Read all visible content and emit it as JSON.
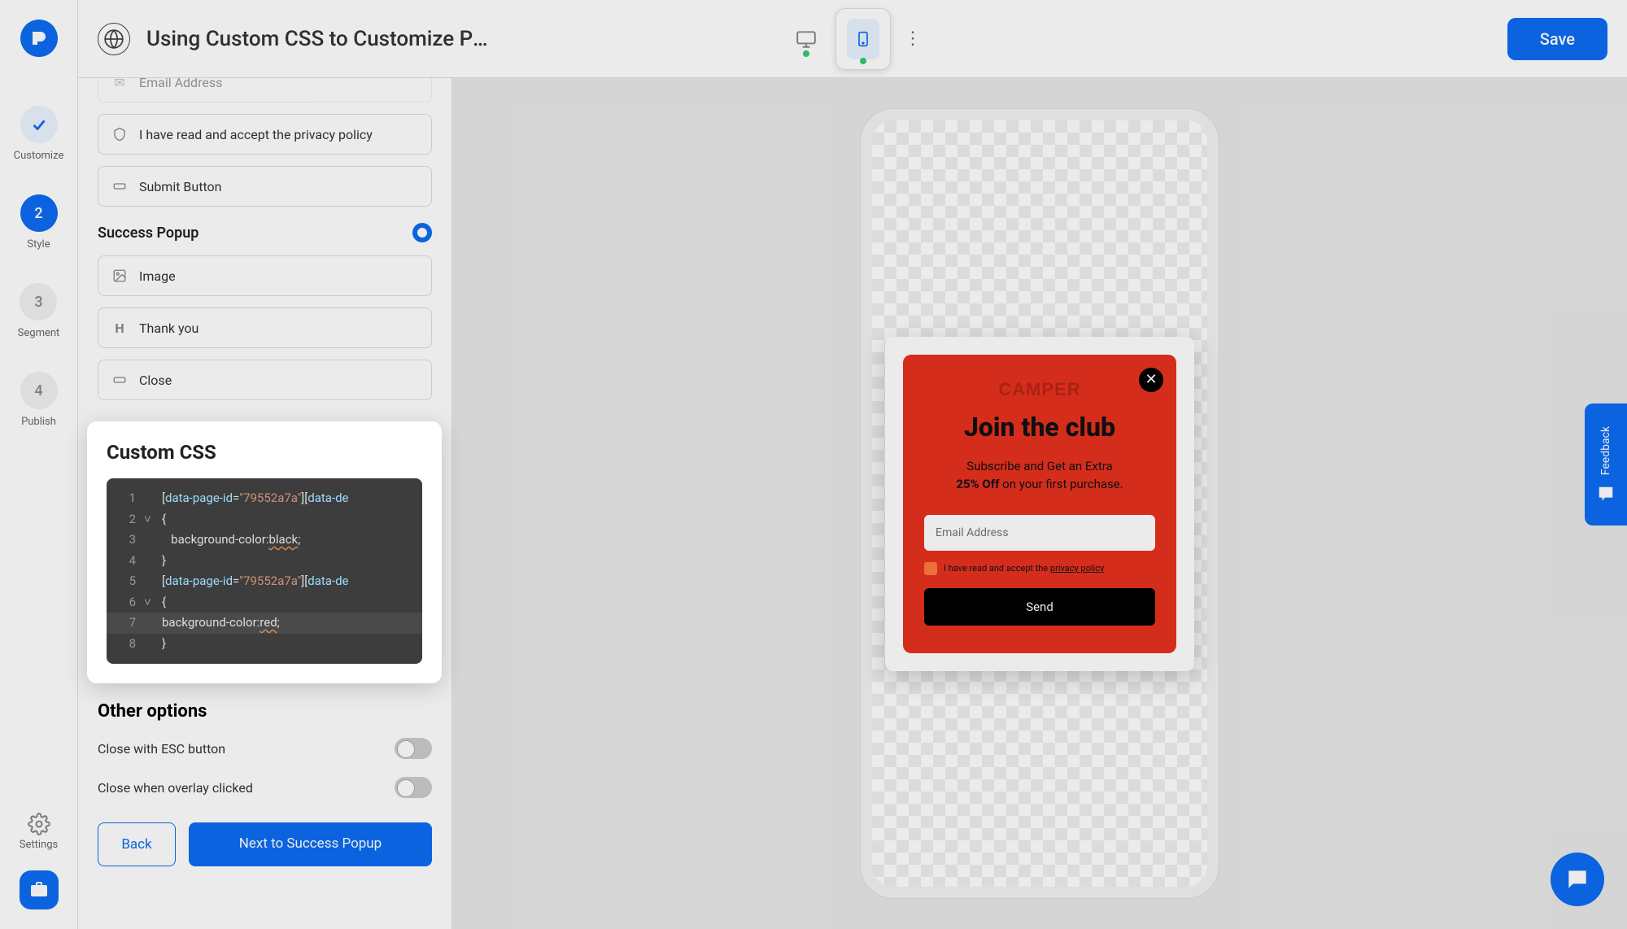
{
  "header": {
    "title": "Using Custom CSS to Customize Pop...",
    "save": "Save"
  },
  "rail": {
    "customize": "Customize",
    "style_num": "2",
    "style": "Style",
    "segment_num": "3",
    "segment": "Segment",
    "publish_num": "4",
    "publish": "Publish",
    "settings": "Settings"
  },
  "sidebar": {
    "email_row": "Email Address",
    "privacy_row": "I have read and accept the privacy policy",
    "submit_row": "Submit Button",
    "success_heading": "Success Popup",
    "image_row": "Image",
    "thank_row": "Thank you",
    "close_row": "Close",
    "css_heading": "Custom CSS",
    "other_heading": "Other options",
    "opt_esc": "Close with ESC button",
    "opt_overlay": "Close when overlay clicked",
    "back": "Back",
    "next": "Next to Success Popup"
  },
  "code": {
    "l1a": "[",
    "l1b": "data-page-id",
    "l1c": "=",
    "l1d": "\"79552a7a\"",
    "l1e": "][",
    "l1f": "data-de",
    "l2": "{",
    "l3a": "background-color:",
    "l3b": "black",
    "l3c": ";",
    "l4": "}",
    "l5a": "[",
    "l5b": "data-page-id",
    "l5c": "=",
    "l5d": "\"79552a7a\"",
    "l5e": "][",
    "l5f": "data-de",
    "l6": "{",
    "l7a": "background-color:",
    "l7b": "red",
    "l7c": ";",
    "l8": "}",
    "n1": "1",
    "n2": "2",
    "n3": "3",
    "n4": "4",
    "n5": "5",
    "n6": "6",
    "n7": "7",
    "n8": "8"
  },
  "popup": {
    "logo": "CAMPER",
    "title": "Join the club",
    "sub_pre": "Subscribe and Get an Extra",
    "sub_bold": "25% Off",
    "sub_post": " on your first purchase.",
    "placeholder": "Email Address",
    "privacy_pre": "I have read and accept the ",
    "privacy_link": "privacy policy",
    "send": "Send"
  },
  "feedback": "Feedback"
}
